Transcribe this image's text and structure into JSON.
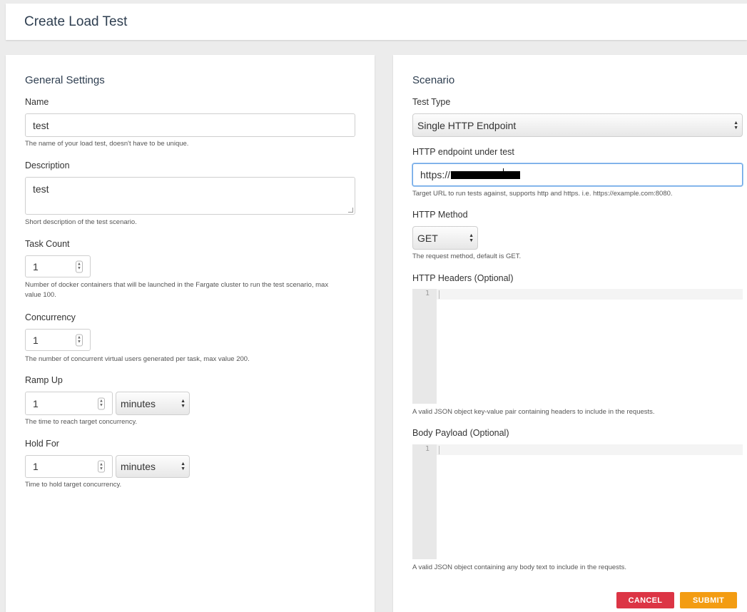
{
  "header": {
    "title": "Create Load Test"
  },
  "general": {
    "title": "General Settings",
    "name": {
      "label": "Name",
      "value": "test",
      "help": "The name of your load test, doesn't have to be unique."
    },
    "description": {
      "label": "Description",
      "value": "test",
      "help": "Short description of the test scenario."
    },
    "task_count": {
      "label": "Task Count",
      "value": "1",
      "help_line1": "Number of docker containers that will be launched in the Fargate cluster to run the test scenario, max",
      "help_line2": "value 100."
    },
    "concurrency": {
      "label": "Concurrency",
      "value": "1",
      "help": "The number of concurrent virtual users generated per task, max value 200."
    },
    "ramp_up": {
      "label": "Ramp Up",
      "value": "1",
      "unit": "minutes",
      "help": "The time to reach target concurrency."
    },
    "hold_for": {
      "label": "Hold For",
      "value": "1",
      "unit": "minutes",
      "help": "Time to hold target concurrency."
    }
  },
  "scenario": {
    "title": "Scenario",
    "test_type": {
      "label": "Test Type",
      "value": "Single HTTP Endpoint"
    },
    "endpoint": {
      "label": "HTTP endpoint under test",
      "value": "https://",
      "help": "Target URL to run tests against, supports http and https. i.e. https://example.com:8080."
    },
    "method": {
      "label": "HTTP Method",
      "value": "GET",
      "help": "The request method, default is GET."
    },
    "headers": {
      "label": "HTTP Headers (Optional)",
      "line_number": "1",
      "help": "A valid JSON object key-value pair containing headers to include in the requests."
    },
    "body": {
      "label": "Body Payload (Optional)",
      "line_number": "1",
      "help": "A valid JSON object containing any body text to include in the requests."
    }
  },
  "actions": {
    "cancel": "CANCEL",
    "submit": "SUBMIT"
  }
}
